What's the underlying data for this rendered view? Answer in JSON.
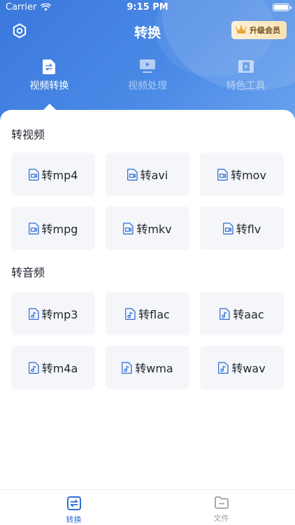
{
  "status_bar": {
    "carrier": "Carrier",
    "time": "9:15 PM"
  },
  "nav": {
    "title": "转换",
    "vip_label": "升级会员"
  },
  "top_tabs": [
    {
      "label": "视频转换",
      "icon": "file-convert-icon",
      "active": true
    },
    {
      "label": "视频处理",
      "icon": "video-monitor-icon",
      "active": false
    },
    {
      "label": "特色工具",
      "icon": "film-icon",
      "active": false
    }
  ],
  "sections": {
    "video": {
      "title": "转视频",
      "items": [
        "转mp4",
        "转avi",
        "转mov",
        "转mpg",
        "转mkv",
        "转flv"
      ]
    },
    "audio": {
      "title": "转音频",
      "items": [
        "转mp3",
        "转flac",
        "转aac",
        "转m4a",
        "转wma",
        "转wav"
      ]
    }
  },
  "bottom_tabs": [
    {
      "label": "转换",
      "icon": "convert-icon",
      "active": true
    },
    {
      "label": "文件",
      "icon": "folder-icon",
      "active": false
    }
  ],
  "colors": {
    "accent": "#2f6fd6",
    "header": "#3a78dc",
    "tile_bg": "#f5f6f9",
    "vip_gold": "#f8e2b4"
  }
}
